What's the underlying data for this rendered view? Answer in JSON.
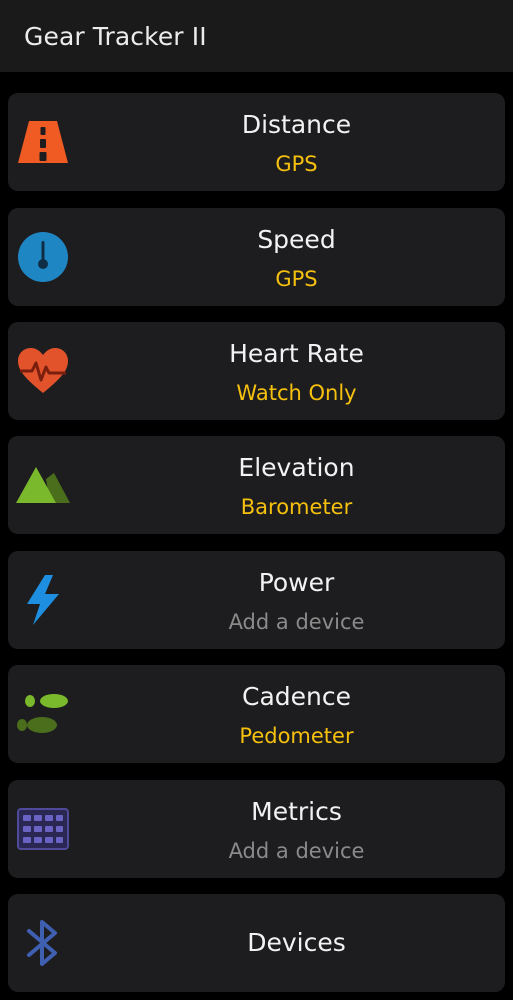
{
  "app_bar": {
    "title": "Gear Tracker II"
  },
  "colors": {
    "background": "#000000",
    "card": "#1d1d1f",
    "app_bar": "#1a1a1a",
    "active_sub": "#f5c00e",
    "inactive_sub": "#8a8a8a"
  },
  "items": [
    {
      "title": "Distance",
      "subtitle": "GPS",
      "status": "active",
      "icon": "road-icon",
      "icon_color": "#f05a23"
    },
    {
      "title": "Speed",
      "subtitle": "GPS",
      "status": "active",
      "icon": "speedometer-icon",
      "icon_color": "#1f86c4"
    },
    {
      "title": "Heart Rate",
      "subtitle": "Watch Only",
      "status": "active",
      "icon": "heart-rate-icon",
      "icon_color": "#e2532c"
    },
    {
      "title": "Elevation",
      "subtitle": "Barometer",
      "status": "active",
      "icon": "mountain-icon",
      "icon_color": "#7ab82c"
    },
    {
      "title": "Power",
      "subtitle": "Add a device",
      "status": "inactive",
      "icon": "lightning-bolt-icon",
      "icon_color": "#1e8fe0"
    },
    {
      "title": "Cadence",
      "subtitle": "Pedometer",
      "status": "active",
      "icon": "footsteps-icon",
      "icon_color": "#7ab82c"
    },
    {
      "title": "Metrics",
      "subtitle": "Add a device",
      "status": "inactive",
      "icon": "metrics-grid-icon",
      "icon_color": "#4f4a9a"
    },
    {
      "title": "Devices",
      "icon": "bluetooth-icon",
      "icon_color": "#3f5fb0"
    }
  ]
}
